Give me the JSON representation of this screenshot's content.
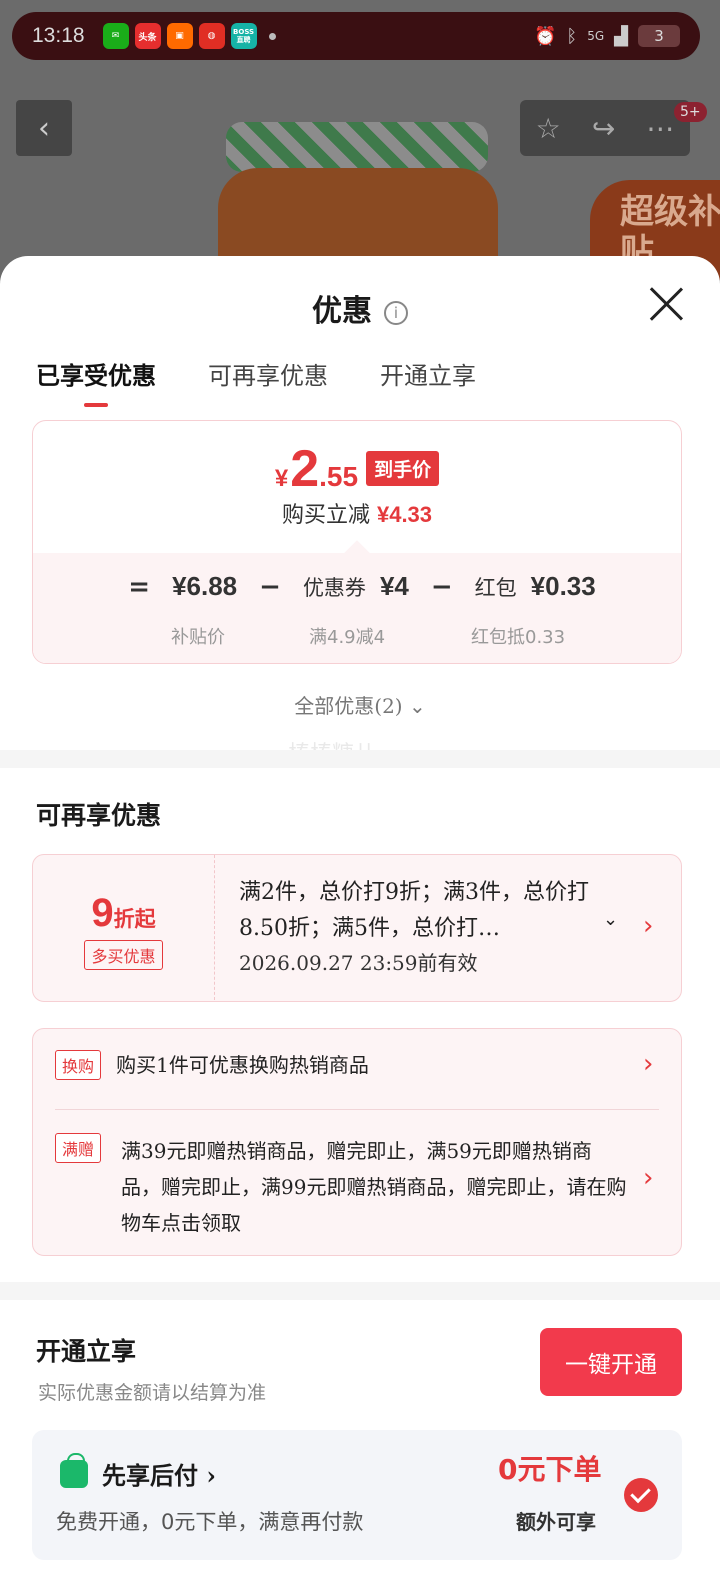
{
  "status_bar": {
    "time": "13:18",
    "apps": [
      {
        "name": "wechat-icon",
        "label": "",
        "color": "#1aad19"
      },
      {
        "name": "toutiao-icon",
        "label": "头条",
        "color": "#e52e2e"
      },
      {
        "name": "taobao-special-icon",
        "label": "",
        "color": "#ff6a00"
      },
      {
        "name": "pinduoduo-icon",
        "label": "",
        "color": "#e02e24"
      },
      {
        "name": "boss-zhipin-icon",
        "label": "BOSS直聘",
        "color": "#16b3a6"
      }
    ],
    "network": "5G",
    "battery": "3"
  },
  "background": {
    "cart_badge": "5+",
    "super_tag": "超级补贴"
  },
  "sheet": {
    "title": "优惠",
    "tabs": [
      "已享受优惠",
      "可再享优惠",
      "开通立享"
    ],
    "active_tab": 0
  },
  "price_card": {
    "yen": "¥",
    "price_int": "2",
    "price_dec": ".55",
    "tag": "到手价",
    "sub_label": "购买立减",
    "sub_value": "¥4.33",
    "formula": {
      "eq": "=",
      "subsidy_value": "¥6.88",
      "minus1": "−",
      "coupon_label": "优惠券",
      "coupon_value": "¥4",
      "minus2": "−",
      "redpack_label": "红包",
      "redpack_value": "¥0.33"
    },
    "labels": {
      "subsidy": "补贴价",
      "coupon": "满4.9减4",
      "redpack": "红包抵0.33"
    }
  },
  "all_offers": "全部优惠(2)",
  "watermark": "棒棒糖儿",
  "more_offers": {
    "title": "可再享优惠",
    "discount": {
      "big": "9",
      "small": "折起",
      "tag": "多买优惠",
      "text": "满2件，总价打9折；满3件，总价打8.50折；满5件，总价打…",
      "date": "2026.09.27 23:59前有效"
    },
    "gifts": [
      {
        "tag": "换购",
        "text": "购买1件可优惠换购热销商品"
      },
      {
        "tag": "满赠",
        "text": "满39元即赠热销商品，赠完即止，满59元即赠热销商品，赠完即止，满99元即赠热销商品，赠完即止，请在购物车点击领取"
      }
    ]
  },
  "open_section": {
    "title": "开通立享",
    "subtitle": "实际优惠金额请以结算为准",
    "button": "一键开通",
    "pay": {
      "title": "先享后付",
      "desc": "免费开通，0元下单，满意再付款",
      "zero": "0元下单",
      "extra": "额外可享"
    }
  },
  "colors": {
    "accent": "#e4393c",
    "button": "#f23a4c",
    "pay_green": "#1bb86a"
  }
}
